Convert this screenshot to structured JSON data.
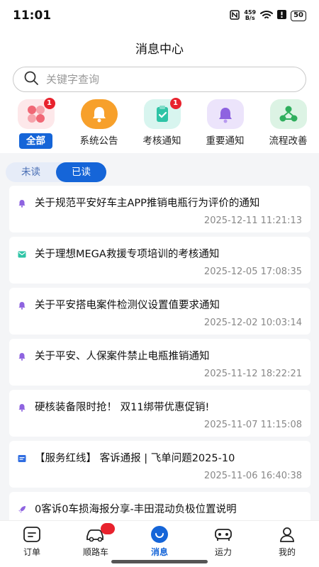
{
  "status": {
    "time": "11:01",
    "speed_top": "459",
    "speed_bottom": "B/s",
    "battery": "50"
  },
  "header": {
    "title": "消息中心"
  },
  "search": {
    "placeholder": "关键字查询"
  },
  "categories": [
    {
      "label": "全部",
      "badge": "1",
      "active": true,
      "icon": "apps-grid-icon"
    },
    {
      "label": "系统公告",
      "badge": "",
      "active": false,
      "icon": "bell-icon"
    },
    {
      "label": "考核通知",
      "badge": "1",
      "active": false,
      "icon": "clipboard-check-icon"
    },
    {
      "label": "重要通知",
      "badge": "",
      "active": false,
      "icon": "alarm-bell-icon"
    },
    {
      "label": "流程改善",
      "badge": "",
      "active": false,
      "icon": "share-nodes-icon"
    }
  ],
  "toggle": {
    "unread": "未读",
    "read": "已读",
    "selected": "read"
  },
  "messages": [
    {
      "icon": "bell-icon",
      "title": "关于规范平安好车主APP推销电瓶行为评价的通知",
      "time": "2025-12-11 11:21:13"
    },
    {
      "icon": "mail-icon",
      "title": "关于理想MEGA救援专项培训的考核通知",
      "time": "2025-12-05 17:08:35"
    },
    {
      "icon": "bell-icon",
      "title": "关于平安搭电案件检测仪设置值要求通知",
      "time": "2025-12-02 10:03:14"
    },
    {
      "icon": "bell-icon",
      "title": "关于平安、人保案件禁止电瓶推销通知",
      "time": "2025-11-12 18:22:21"
    },
    {
      "icon": "bell-icon",
      "title": "硬核装备限时抢！ 双11绑带优惠促销!",
      "time": "2025-11-07 11:15:08"
    },
    {
      "icon": "document-icon",
      "title": "【服务红线】 客诉通报 | 飞单问题2025-10",
      "time": "2025-11-06 16:40:38"
    },
    {
      "icon": "rocket-icon",
      "title": "0客诉0车损海报分享-丰田混动负极位置说明",
      "time": ""
    }
  ],
  "tabbar": [
    {
      "label": "订单",
      "icon": "order-icon"
    },
    {
      "label": "顺路车",
      "icon": "car-icon"
    },
    {
      "label": "消息",
      "icon": "message-icon",
      "active": true
    },
    {
      "label": "运力",
      "icon": "capacity-car-icon"
    },
    {
      "label": "我的",
      "icon": "user-icon"
    }
  ],
  "colors": {
    "accent": "#1565d8",
    "badge": "#e8222d"
  }
}
